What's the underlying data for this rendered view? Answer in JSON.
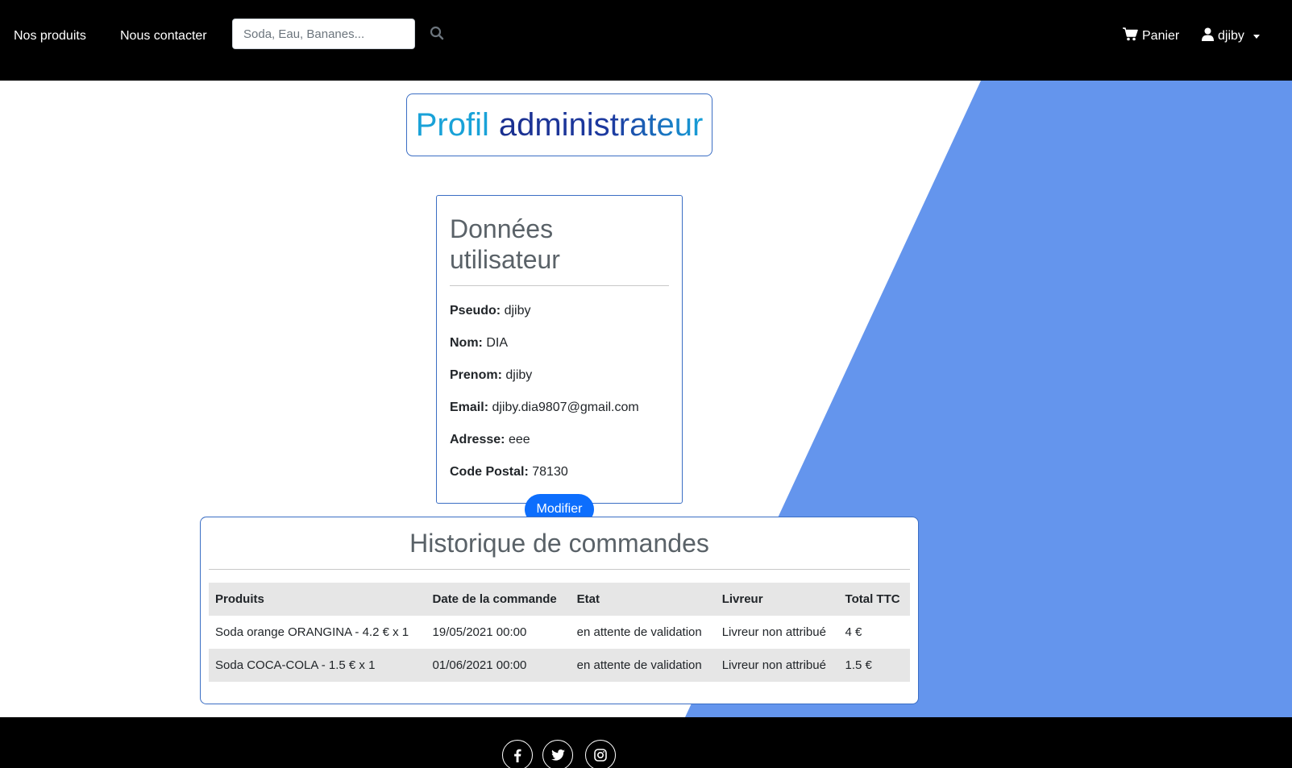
{
  "nav": {
    "products": "Nos produits",
    "contact": "Nous contacter",
    "search_placeholder": "Soda, Eau, Bananes...",
    "cart": "Panier",
    "user": "djiby"
  },
  "page": {
    "title_word1": "Profil",
    "title_word2": "administrateur"
  },
  "user_card": {
    "heading": "Données utilisateur",
    "fields": [
      {
        "label": "Pseudo:",
        "value": "djiby"
      },
      {
        "label": "Nom:",
        "value": "DIA"
      },
      {
        "label": "Prenom:",
        "value": "djiby"
      },
      {
        "label": "Email:",
        "value": "djiby.dia9807@gmail.com"
      },
      {
        "label": "Adresse:",
        "value": "eee"
      },
      {
        "label": "Code Postal:",
        "value": "78130"
      }
    ],
    "modify_label": "Modifier"
  },
  "orders": {
    "heading": "Historique de commandes",
    "columns": [
      "Produits",
      "Date de la commande",
      "Etat",
      "Livreur",
      "Total TTC"
    ],
    "rows": [
      [
        "Soda orange ORANGINA - 4.2 € x 1",
        "19/05/2021 00:00",
        "en attente de validation",
        "Livreur non attribué",
        "4 €"
      ],
      [
        "Soda COCA-COLA - 1.5 € x 1",
        "01/06/2021 00:00",
        "en attente de validation",
        "Livreur non attribué",
        "1.5 €"
      ]
    ]
  },
  "footer": {
    "social": [
      "facebook-icon",
      "twitter-icon",
      "instagram-icon"
    ]
  },
  "colors": {
    "navbar": "#000000",
    "accent_blue": "#6495ED",
    "button": "#0d6efd",
    "card_border": "#3b6ec4"
  }
}
